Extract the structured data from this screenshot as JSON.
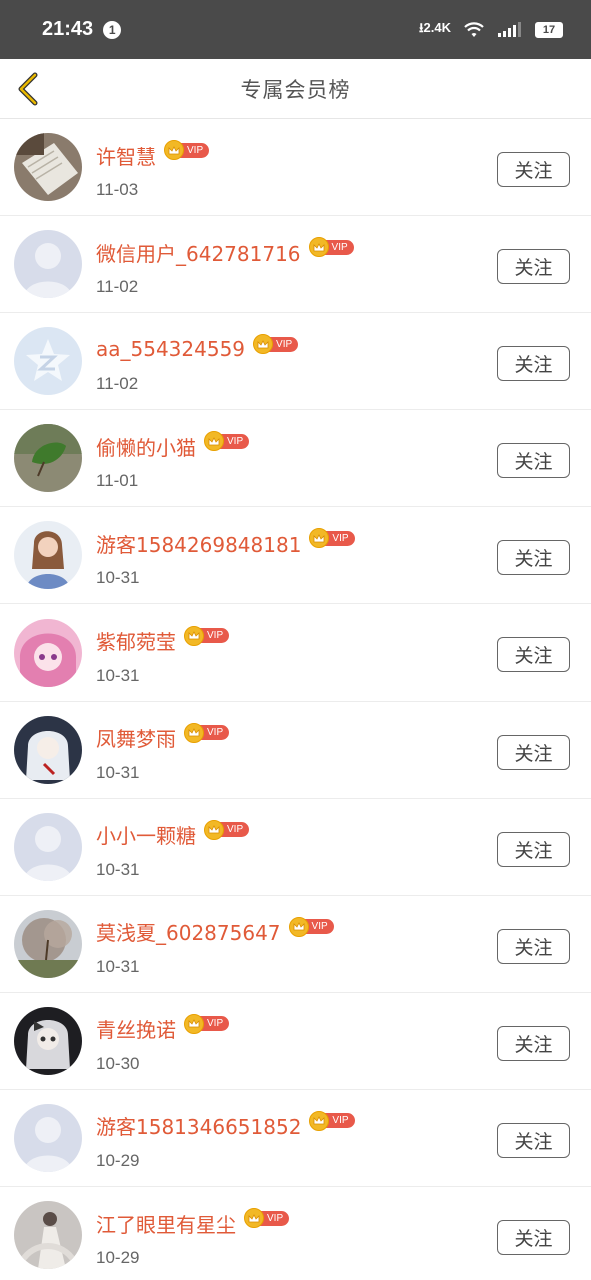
{
  "status_bar": {
    "time": "21:43",
    "notification_count": "1",
    "net_speed": "2.4K",
    "battery": "17"
  },
  "nav": {
    "title": "专属会员榜"
  },
  "vip_label": "VIP",
  "follow_label": "关注",
  "members": [
    {
      "name": "许智慧",
      "date": "11-03",
      "avatar": "book-photo"
    },
    {
      "name": "微信用户_642781716",
      "date": "11-02",
      "avatar": "default-avatar"
    },
    {
      "name": "aa_554324559",
      "date": "11-02",
      "avatar": "qq-avatar"
    },
    {
      "name": "偷懒的小猫",
      "date": "11-01",
      "avatar": "leaf-photo"
    },
    {
      "name": "游客1584269848181",
      "date": "10-31",
      "avatar": "girl-photo"
    },
    {
      "name": "紫郁菀莹",
      "date": "10-31",
      "avatar": "anime-pink"
    },
    {
      "name": "凤舞梦雨",
      "date": "10-31",
      "avatar": "anime-white"
    },
    {
      "name": "小小一颗糖",
      "date": "10-31",
      "avatar": "default-avatar"
    },
    {
      "name": "莫浅夏_602875647",
      "date": "10-31",
      "avatar": "tree-photo"
    },
    {
      "name": "青丝挽诺",
      "date": "10-30",
      "avatar": "anime-dark"
    },
    {
      "name": "游客1581346651852",
      "date": "10-29",
      "avatar": "default-avatar"
    },
    {
      "name": "江了眼里有星尘",
      "date": "10-29",
      "avatar": "dress-photo"
    }
  ],
  "colors": {
    "name": "#e05a38",
    "vip_badge": "#e8594a",
    "crown": "#f2b826",
    "back_arrow": "#e8b800"
  }
}
